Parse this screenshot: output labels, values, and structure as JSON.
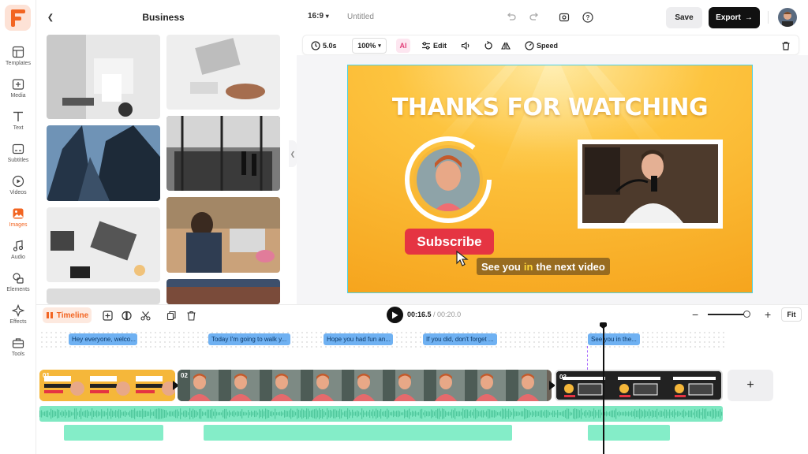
{
  "rail": {
    "items": [
      {
        "label": "Templates",
        "icon": "templates-icon"
      },
      {
        "label": "Media",
        "icon": "media-icon"
      },
      {
        "label": "Text",
        "icon": "text-icon"
      },
      {
        "label": "Subtitles",
        "icon": "subtitles-icon"
      },
      {
        "label": "Videos",
        "icon": "videos-icon"
      },
      {
        "label": "Images",
        "icon": "images-icon",
        "active": true
      },
      {
        "label": "Audio",
        "icon": "audio-icon"
      },
      {
        "label": "Elements",
        "icon": "elements-icon"
      },
      {
        "label": "Effects",
        "icon": "effects-icon"
      },
      {
        "label": "Tools",
        "icon": "tools-icon"
      }
    ]
  },
  "panel": {
    "title": "Business"
  },
  "topbar": {
    "aspect": "16:9",
    "project_name": "Untitled",
    "save_label": "Save",
    "export_label": "Export"
  },
  "toolbar": {
    "duration": "5.0s",
    "zoom": "100%",
    "edit_label": "Edit",
    "speed_label": "Speed"
  },
  "stage": {
    "title": "THANKS FOR WATCHING",
    "subscribe_label": "Subscribe",
    "caption_pre": "See you",
    "caption_highlight": "in",
    "caption_post": "the next video"
  },
  "timeline": {
    "tab_label": "Timeline",
    "current_time": "00:16.5",
    "separator": " / ",
    "total_time": "00:20.0",
    "fit_label": "Fit",
    "subtitles": [
      "Hey everyone, welco...",
      "Today I'm going to walk y...",
      "Hope you had fun an...",
      "If you did, don't forget ...",
      "See you in the..."
    ],
    "clips": [
      {
        "num": "01"
      },
      {
        "num": "02"
      },
      {
        "num": "03"
      }
    ]
  },
  "colors": {
    "accent": "#f26522",
    "stage_yellow": "#fbbd2e",
    "subscribe_red": "#e53442",
    "subtitle_chip": "#6fb1f2",
    "audio_wave": "#7fe8c2"
  }
}
